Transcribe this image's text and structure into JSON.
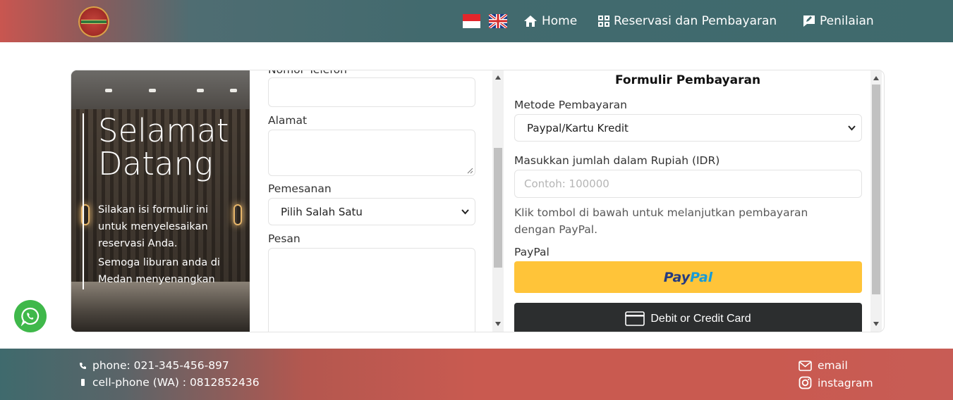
{
  "header": {
    "nav": {
      "home": "Home",
      "reservation": "Reservasi dan Pembayaran",
      "rating": "Penilaian"
    }
  },
  "hero": {
    "title": "Selamat Datang",
    "text1": "Silakan isi formulir ini untuk menyelesaikan reservasi Anda.",
    "text2": "Semoga liburan anda di Medan menyenangkan"
  },
  "booking_form": {
    "phone_label": "Nomor Telefon",
    "address_label": "Alamat",
    "order_label": "Pemesanan",
    "order_selected": "Pilih Salah Satu",
    "message_label": "Pesan"
  },
  "payment_form": {
    "title": "Formulir Pembayaran",
    "method_label": "Metode Pembayaran",
    "method_selected": "Paypal/Kartu Kredit",
    "amount_label": "Masukkan jumlah dalam Rupiah (IDR)",
    "amount_placeholder": "Contoh: 100000",
    "instruction": "Klik tombol di bawah untuk melanjutkan pembayaran dengan PayPal.",
    "paypal_label": "PayPal",
    "paypal_button_part1": "Pay",
    "paypal_button_part2": "Pal",
    "card_button": "Debit or Credit Card"
  },
  "footer": {
    "phone": "phone: 021-345-456-897",
    "cell_phone": "cell-phone (WA) : 0812852436",
    "email": "email",
    "instagram": "instagram"
  },
  "colors": {
    "paypal_yellow": "#ffc439",
    "paypal_dark": "#253b80",
    "paypal_light": "#179bd7",
    "card_button": "#2c2e2f",
    "whatsapp": "#3fb84a"
  }
}
